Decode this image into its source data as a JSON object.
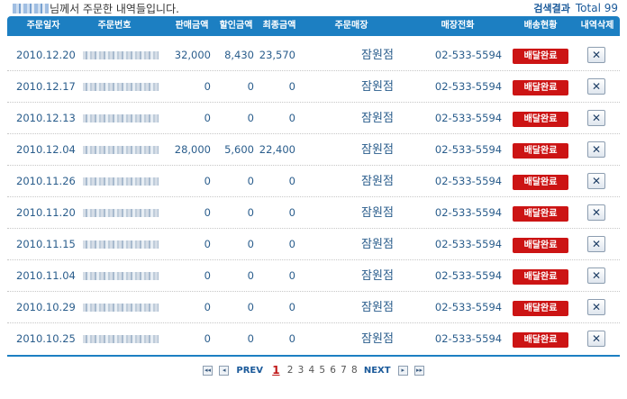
{
  "header": {
    "greeting_suffix": "님께서 주문한 내역들입니다.",
    "result_label": "검색결과",
    "total_label": "Total 99"
  },
  "table": {
    "columns": [
      "주문일자",
      "주문번호",
      "판매금액",
      "할인금액",
      "최종금액",
      "주문매장",
      "매장전화",
      "배송현황",
      "내역삭제"
    ],
    "rows": [
      {
        "date": "2010.12.20",
        "sale": "32,000",
        "discount": "8,430",
        "final": "23,570",
        "store": "잠원점",
        "phone": "02-533-5594",
        "status": "배달완료",
        "delete": "✕"
      },
      {
        "date": "2010.12.17",
        "sale": "0",
        "discount": "0",
        "final": "0",
        "store": "잠원점",
        "phone": "02-533-5594",
        "status": "배달완료",
        "delete": "✕"
      },
      {
        "date": "2010.12.13",
        "sale": "0",
        "discount": "0",
        "final": "0",
        "store": "잠원점",
        "phone": "02-533-5594",
        "status": "배달완료",
        "delete": "✕"
      },
      {
        "date": "2010.12.04",
        "sale": "28,000",
        "discount": "5,600",
        "final": "22,400",
        "store": "잠원점",
        "phone": "02-533-5594",
        "status": "배달완료",
        "delete": "✕"
      },
      {
        "date": "2010.11.26",
        "sale": "0",
        "discount": "0",
        "final": "0",
        "store": "잠원점",
        "phone": "02-533-5594",
        "status": "배달완료",
        "delete": "✕"
      },
      {
        "date": "2010.11.20",
        "sale": "0",
        "discount": "0",
        "final": "0",
        "store": "잠원점",
        "phone": "02-533-5594",
        "status": "배달완료",
        "delete": "✕"
      },
      {
        "date": "2010.11.15",
        "sale": "0",
        "discount": "0",
        "final": "0",
        "store": "잠원점",
        "phone": "02-533-5594",
        "status": "배달완료",
        "delete": "✕"
      },
      {
        "date": "2010.11.04",
        "sale": "0",
        "discount": "0",
        "final": "0",
        "store": "잠원점",
        "phone": "02-533-5594",
        "status": "배달완료",
        "delete": "✕"
      },
      {
        "date": "2010.10.29",
        "sale": "0",
        "discount": "0",
        "final": "0",
        "store": "잠원점",
        "phone": "02-533-5594",
        "status": "배달완료",
        "delete": "✕"
      },
      {
        "date": "2010.10.25",
        "sale": "0",
        "discount": "0",
        "final": "0",
        "store": "잠원점",
        "phone": "02-533-5594",
        "status": "배달완료",
        "delete": "✕"
      }
    ]
  },
  "pagination": {
    "first_icon": "first-page-icon",
    "prev_icon": "prev-page-icon",
    "next_icon": "next-page-icon",
    "last_icon": "last-page-icon",
    "first_glyph": "◂◂",
    "prev_glyph": "◂",
    "next_glyph": "▸",
    "last_glyph": "▸▸",
    "prev_label": "PREV",
    "next_label": "NEXT",
    "pages": [
      "1",
      "2",
      "3",
      "4",
      "5",
      "6",
      "7",
      "8"
    ],
    "current_page": "1"
  },
  "colors": {
    "header_bg": "#1c7fc2",
    "text_blue": "#2a5d8c",
    "badge_red": "#cc1414",
    "current_page_red": "#c01818"
  }
}
